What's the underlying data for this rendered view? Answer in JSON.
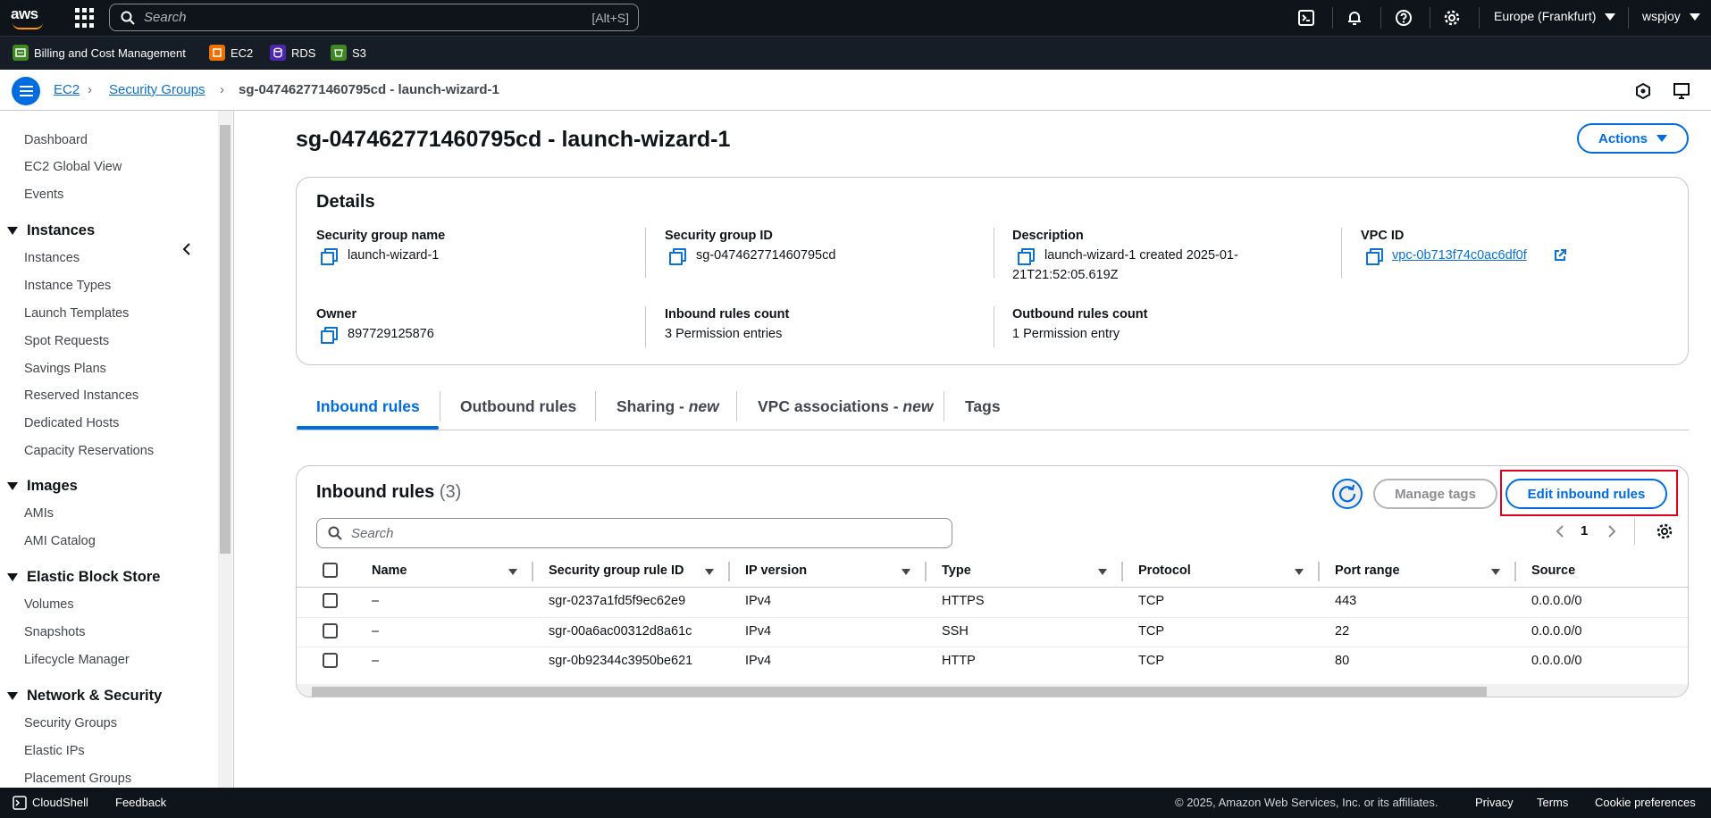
{
  "topnav": {
    "logo_text": "aws",
    "search_placeholder": "Search",
    "search_shortcut": "[Alt+S]",
    "region": "Europe (Frankfurt)",
    "user": "wspjoy",
    "icons": [
      "cloudshell-icon",
      "bell-icon",
      "help-icon",
      "gear-icon"
    ]
  },
  "favorites": [
    {
      "label": "Billing and Cost Management",
      "icon": "billing-icon",
      "color": "#3f8624"
    },
    {
      "label": "EC2",
      "icon": "ec2-icon",
      "color": "#ed7100"
    },
    {
      "label": "RDS",
      "icon": "rds-icon",
      "color": "#4d27aa"
    },
    {
      "label": "S3",
      "icon": "s3-icon",
      "color": "#3f8624"
    }
  ],
  "breadcrumb": {
    "items": [
      "EC2",
      "Security Groups"
    ],
    "current": "sg-047462771460795cd - launch-wizard-1"
  },
  "sidebar": {
    "top_items": [
      "Dashboard",
      "EC2 Global View",
      "Events"
    ],
    "sections": [
      {
        "title": "Instances",
        "items": [
          "Instances",
          "Instance Types",
          "Launch Templates",
          "Spot Requests",
          "Savings Plans",
          "Reserved Instances",
          "Dedicated Hosts",
          "Capacity Reservations"
        ]
      },
      {
        "title": "Images",
        "items": [
          "AMIs",
          "AMI Catalog"
        ]
      },
      {
        "title": "Elastic Block Store",
        "items": [
          "Volumes",
          "Snapshots",
          "Lifecycle Manager"
        ]
      },
      {
        "title": "Network & Security",
        "items": [
          "Security Groups",
          "Elastic IPs",
          "Placement Groups"
        ]
      }
    ]
  },
  "page": {
    "title": "sg-047462771460795cd - launch-wizard-1",
    "actions_label": "Actions"
  },
  "details": {
    "heading": "Details",
    "fields": [
      {
        "label": "Security group name",
        "value": "launch-wizard-1"
      },
      {
        "label": "Security group ID",
        "value": "sg-047462771460795cd"
      },
      {
        "label": "Description",
        "value_line1": "launch-wizard-1 created 2025-01-",
        "value_line2": "21T21:52:05.619Z"
      },
      {
        "label": "VPC ID",
        "value": "vpc-0b713f74c0ac6df0f"
      },
      {
        "label": "Owner",
        "value": "897729125876"
      },
      {
        "label": "Inbound rules count",
        "value": "3 Permission entries"
      },
      {
        "label": "Outbound rules count",
        "value": "1 Permission entry"
      }
    ]
  },
  "tabs": [
    {
      "label": "Inbound rules",
      "suffix": ""
    },
    {
      "label": "Outbound rules",
      "suffix": ""
    },
    {
      "label": "Sharing - ",
      "suffix": "new"
    },
    {
      "label": "VPC associations - ",
      "suffix": "new"
    },
    {
      "label": "Tags",
      "suffix": ""
    }
  ],
  "inbound": {
    "heading": "Inbound rules",
    "count": "(3)",
    "manage_tags": "Manage tags",
    "edit_rules": "Edit inbound rules",
    "search_placeholder": "Search",
    "page": "1",
    "columns": [
      "Name",
      "Security group rule ID",
      "IP version",
      "Type",
      "Protocol",
      "Port range",
      "Source"
    ],
    "rows": [
      [
        "–",
        "sgr-0237a1fd5f9ec62e9",
        "IPv4",
        "HTTPS",
        "TCP",
        "443",
        "0.0.0.0/0"
      ],
      [
        "–",
        "sgr-00a6ac00312d8a61c",
        "IPv4",
        "SSH",
        "TCP",
        "22",
        "0.0.0.0/0"
      ],
      [
        "–",
        "sgr-0b92344c3950be621",
        "IPv4",
        "HTTP",
        "TCP",
        "80",
        "0.0.0.0/0"
      ]
    ]
  },
  "footer": {
    "cloudshell": "CloudShell",
    "feedback": "Feedback",
    "copyright": "© 2025, Amazon Web Services, Inc. or its affiliates.",
    "privacy": "Privacy",
    "terms": "Terms",
    "cookies": "Cookie preferences"
  },
  "colors": {
    "accent": "#006ce0",
    "link": "#0972d3",
    "topnav": "#0f141a",
    "highlight": "#e0001b"
  }
}
